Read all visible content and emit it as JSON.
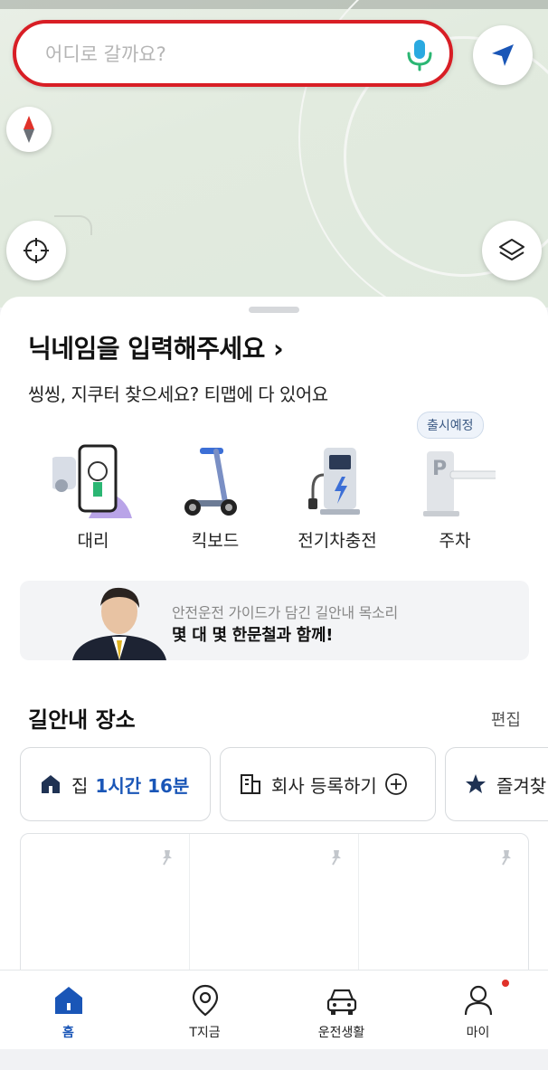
{
  "search": {
    "placeholder": "어디로 갈까요?"
  },
  "map_icons": {
    "mic": "mic-icon",
    "navigate": "navigation-arrow-icon",
    "compass": "compass-icon",
    "locate": "crosshair-icon",
    "layers": "layers-icon"
  },
  "profile": {
    "nickname_prompt": "닉네임을 입력해주세요 ›",
    "tagline": "씽씽, 지쿠터 찾으세요? 티맵에 다 있어요"
  },
  "services": [
    {
      "label": "대리",
      "icon": "designated-driver-icon"
    },
    {
      "label": "킥보드",
      "icon": "kickboard-icon"
    },
    {
      "label": "전기차충전",
      "icon": "ev-charger-icon"
    },
    {
      "label": "주차",
      "icon": "parking-icon"
    }
  ],
  "badge": {
    "coming_soon": "출시예정"
  },
  "banner": {
    "line1": "안전운전 가이드가 담긴 길안내 목소리",
    "line2": "몇 대 몇 한문철과 함께!"
  },
  "places": {
    "title": "길안내 장소",
    "edit": "편집",
    "home": {
      "label": "집",
      "time": "1시간 16분"
    },
    "work": {
      "label": "회사 등록하기"
    },
    "favorites": {
      "label": "즐겨찾"
    }
  },
  "tabs": [
    {
      "label": "홈",
      "icon": "home-icon",
      "active": true
    },
    {
      "label": "T지금",
      "icon": "location-pin-icon"
    },
    {
      "label": "운전생활",
      "icon": "car-icon"
    },
    {
      "label": "마이",
      "icon": "person-icon"
    }
  ],
  "colors": {
    "accent": "#1a56b7",
    "search_border": "#d81e25",
    "notification": "#e0322a"
  }
}
